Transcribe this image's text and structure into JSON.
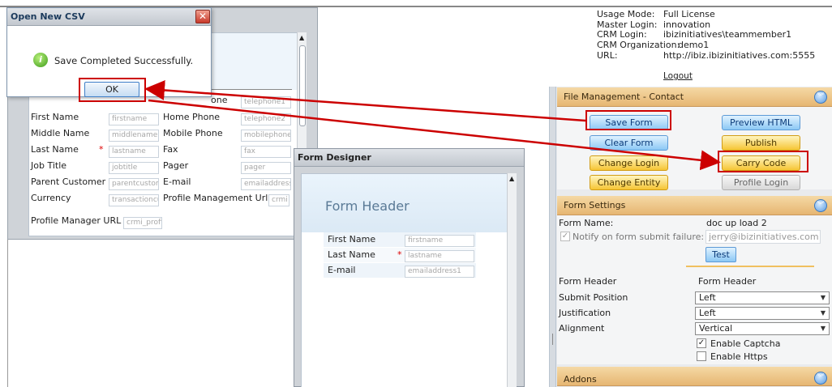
{
  "info": {
    "rows": [
      {
        "k": "Usage Mode:",
        "v": "Full License"
      },
      {
        "k": "Master Login:",
        "v": "innovation"
      },
      {
        "k": "CRM Login:",
        "v": "ibizinitiatives\\teammember1"
      },
      {
        "k": "CRM Organization:",
        "v": "demo1"
      },
      {
        "k": "URL:",
        "v": "http://ibiz.ibizinitiatives.com:5555"
      }
    ],
    "logout": "Logout"
  },
  "dialog": {
    "title": "Open New CSV",
    "message": "Save Completed Successfully.",
    "ok": "OK"
  },
  "form_bg": {
    "fields": [
      {
        "left": "First Name",
        "left_ph": "firstname",
        "right": "Home Phone",
        "right_ph": "telephone2"
      },
      {
        "left": "Middle Name",
        "left_ph": "middlename",
        "right": "Mobile Phone",
        "right_ph": "mobilephone"
      },
      {
        "left": "Last Name",
        "left_ph": "lastname",
        "right": "Fax",
        "right_ph": "fax"
      },
      {
        "left": "Job Title",
        "left_ph": "jobtitle",
        "right": "Pager",
        "right_ph": "pager"
      },
      {
        "left": "Parent Customer",
        "left_ph": "parentcustom",
        "right": "E-mail",
        "right_ph": "emailaddress"
      },
      {
        "left": "Currency",
        "left_ph": "transactioncur",
        "right": "Profile Management Url",
        "right_ph": "crmi"
      }
    ],
    "top_right_label": "one",
    "top_right_ph": "telephone1",
    "last": {
      "label": "Profile Manager URL",
      "ph": "crmi_profi"
    }
  },
  "form_designer": {
    "title": "Form Designer",
    "header": "Form Header",
    "fields": [
      {
        "label": "First Name",
        "ph": "firstname",
        "req": false
      },
      {
        "label": "Last Name",
        "ph": "lastname",
        "req": true
      },
      {
        "label": "E-mail",
        "ph": "emailaddress1",
        "req": false
      }
    ]
  },
  "file_mgmt": {
    "title": "File Management - Contact",
    "save": "Save Form",
    "preview": "Preview HTML",
    "clear": "Clear Form",
    "publish": "Publish",
    "change_login": "Change Login",
    "carry": "Carry Code",
    "change_entity": "Change Entity",
    "profile_login": "Profile Login"
  },
  "settings": {
    "title": "Form Settings",
    "form_name_label": "Form Name:",
    "form_name_value": "doc up load 2",
    "notify_label": "Notify on form submit failure:",
    "notify_value": "jerry@ibizinitiatives.com",
    "test": "Test",
    "form_header_label": "Form Header",
    "form_header_value": "Form Header",
    "submit_label": "Submit Position",
    "submit_value": "Left",
    "justification_label": "Justification",
    "justification_value": "Left",
    "alignment_label": "Alignment",
    "alignment_value": "Vertical",
    "captcha": "Enable Captcha",
    "https": "Enable Https"
  },
  "addons": {
    "title": "Addons"
  },
  "colors": {
    "accent": "#c00000",
    "panel": "#e6b672",
    "blue_btn": "#8cc8f5",
    "yellow_btn": "#f6c534"
  }
}
